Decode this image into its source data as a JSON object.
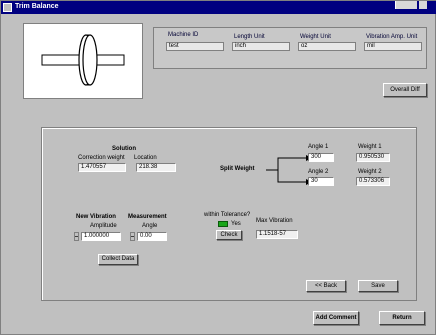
{
  "window": {
    "title": "Trim Balance"
  },
  "machine_info": {
    "fields": [
      {
        "label": "Machine ID",
        "value": "test"
      },
      {
        "label": "Length Unit",
        "value": "inch"
      },
      {
        "label": "Weight Unit",
        "value": "oz"
      },
      {
        "label": "Vibration Amp. Unit",
        "value": "mil"
      }
    ]
  },
  "buttons": {
    "overall_diff": "Overall Diff",
    "collect_data": "Collect Data",
    "back": "<< Back",
    "save": "Save",
    "add_comment": "Add Comment",
    "return": "Return"
  },
  "solution": {
    "heading": "Solution",
    "correction_weight_label": "Correction weight",
    "location_label": "Location",
    "correction_weight": "1.470557",
    "location": "218.38"
  },
  "split_weight": {
    "label": "Split Weight",
    "angle1_label": "Angle 1",
    "angle1": "300",
    "angle2_label": "Angle 2",
    "angle2": "30",
    "weight1_label": "Weight 1",
    "weight1": "0.950530",
    "weight2_label": "Weight 2",
    "weight2": "0.573306"
  },
  "new_vibration": {
    "heading1": "New Vibration",
    "heading2": "Measurement",
    "amplitude_label": "Amplitude",
    "amplitude": "1.000000",
    "angle_label": "Angle",
    "angle": "0.00"
  },
  "status": {
    "indicator_label": "within Tolerance?",
    "indicator_value": "Yes",
    "check_button": "Check",
    "max_vibration_label": "Max Vibration",
    "max_vibration": "1.1518-57"
  },
  "colors": {
    "titlebar": "#000080",
    "face": "#c0c0c0",
    "led": "#1aa61a"
  }
}
